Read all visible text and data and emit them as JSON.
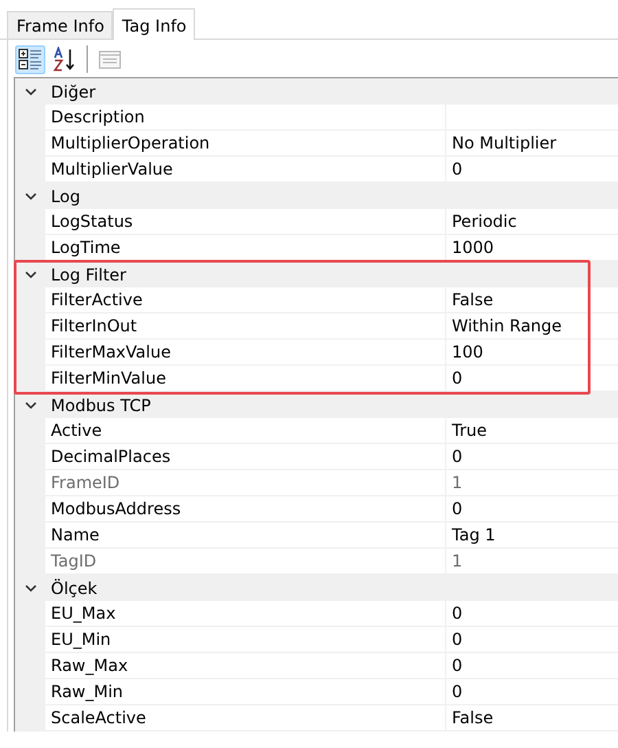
{
  "tabs": [
    {
      "label": "Frame Info",
      "selected": false
    },
    {
      "label": "Tag Info",
      "selected": true
    }
  ],
  "toolbar": [
    {
      "kind": "categorized",
      "selected": true,
      "disabled": false
    },
    {
      "kind": "alphabetical",
      "selected": false,
      "disabled": false
    },
    {
      "kind": "separator"
    },
    {
      "kind": "property-pages",
      "selected": false,
      "disabled": true
    }
  ],
  "categories": [
    {
      "title": "Diğer",
      "expanded": true,
      "highlighted": false,
      "rows": [
        {
          "name": "Description",
          "value": "",
          "disabled": false
        },
        {
          "name": "MultiplierOperation",
          "value": "No Multiplier",
          "disabled": false
        },
        {
          "name": "MultiplierValue",
          "value": "0",
          "disabled": false
        }
      ]
    },
    {
      "title": "Log",
      "expanded": true,
      "highlighted": false,
      "rows": [
        {
          "name": "LogStatus",
          "value": "Periodic",
          "disabled": false
        },
        {
          "name": "LogTime",
          "value": "1000",
          "disabled": false
        }
      ]
    },
    {
      "title": "Log Filter",
      "expanded": true,
      "highlighted": true,
      "rows": [
        {
          "name": "FilterActive",
          "value": "False",
          "disabled": false
        },
        {
          "name": "FilterInOut",
          "value": "Within Range",
          "disabled": false
        },
        {
          "name": "FilterMaxValue",
          "value": "100",
          "disabled": false
        },
        {
          "name": "FilterMinValue",
          "value": "0",
          "disabled": false
        }
      ]
    },
    {
      "title": "Modbus TCP",
      "expanded": true,
      "highlighted": false,
      "rows": [
        {
          "name": "Active",
          "value": "True",
          "disabled": false
        },
        {
          "name": "DecimalPlaces",
          "value": "0",
          "disabled": false
        },
        {
          "name": "FrameID",
          "value": "1",
          "disabled": true
        },
        {
          "name": "ModbusAddress",
          "value": "0",
          "disabled": false
        },
        {
          "name": "Name",
          "value": "Tag 1",
          "disabled": false
        },
        {
          "name": "TagID",
          "value": "1",
          "disabled": true
        }
      ]
    },
    {
      "title": "Ölçek",
      "expanded": true,
      "highlighted": false,
      "rows": [
        {
          "name": "EU_Max",
          "value": "0",
          "disabled": false
        },
        {
          "name": "EU_Min",
          "value": "0",
          "disabled": false
        },
        {
          "name": "Raw_Max",
          "value": "0",
          "disabled": false
        },
        {
          "name": "Raw_Min",
          "value": "0",
          "disabled": false
        },
        {
          "name": "ScaleActive",
          "value": "False",
          "disabled": false
        }
      ]
    }
  ]
}
